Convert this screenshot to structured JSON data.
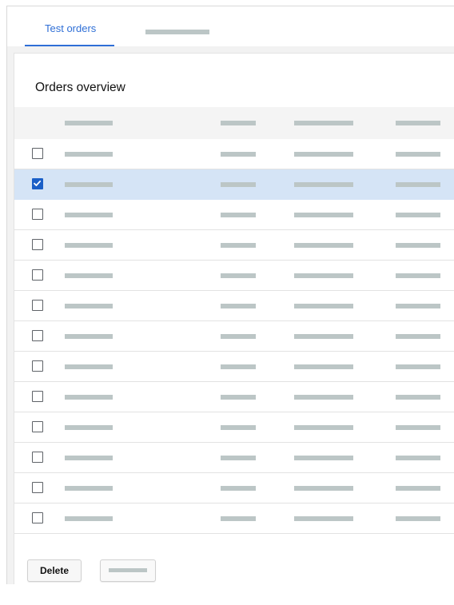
{
  "tabs": [
    {
      "label": "Test orders",
      "active": true
    },
    {
      "label": "",
      "active": false
    }
  ],
  "card": {
    "title": "Orders overview"
  },
  "table": {
    "columns": [
      "",
      "",
      "",
      ""
    ],
    "rows": [
      {
        "checked": false
      },
      {
        "checked": true
      },
      {
        "checked": false
      },
      {
        "checked": false
      },
      {
        "checked": false
      },
      {
        "checked": false
      },
      {
        "checked": false
      },
      {
        "checked": false
      },
      {
        "checked": false
      },
      {
        "checked": false
      },
      {
        "checked": false
      },
      {
        "checked": false
      },
      {
        "checked": false
      }
    ]
  },
  "footer": {
    "delete_label": "Delete",
    "secondary_label": ""
  },
  "colors": {
    "accent": "#2f6fd6",
    "selected_row": "#d5e4f6",
    "checkbox_checked": "#1a5fc7",
    "placeholder": "#bcc6c6"
  },
  "icons": {
    "checkbox_checked": "checkmark-icon"
  }
}
